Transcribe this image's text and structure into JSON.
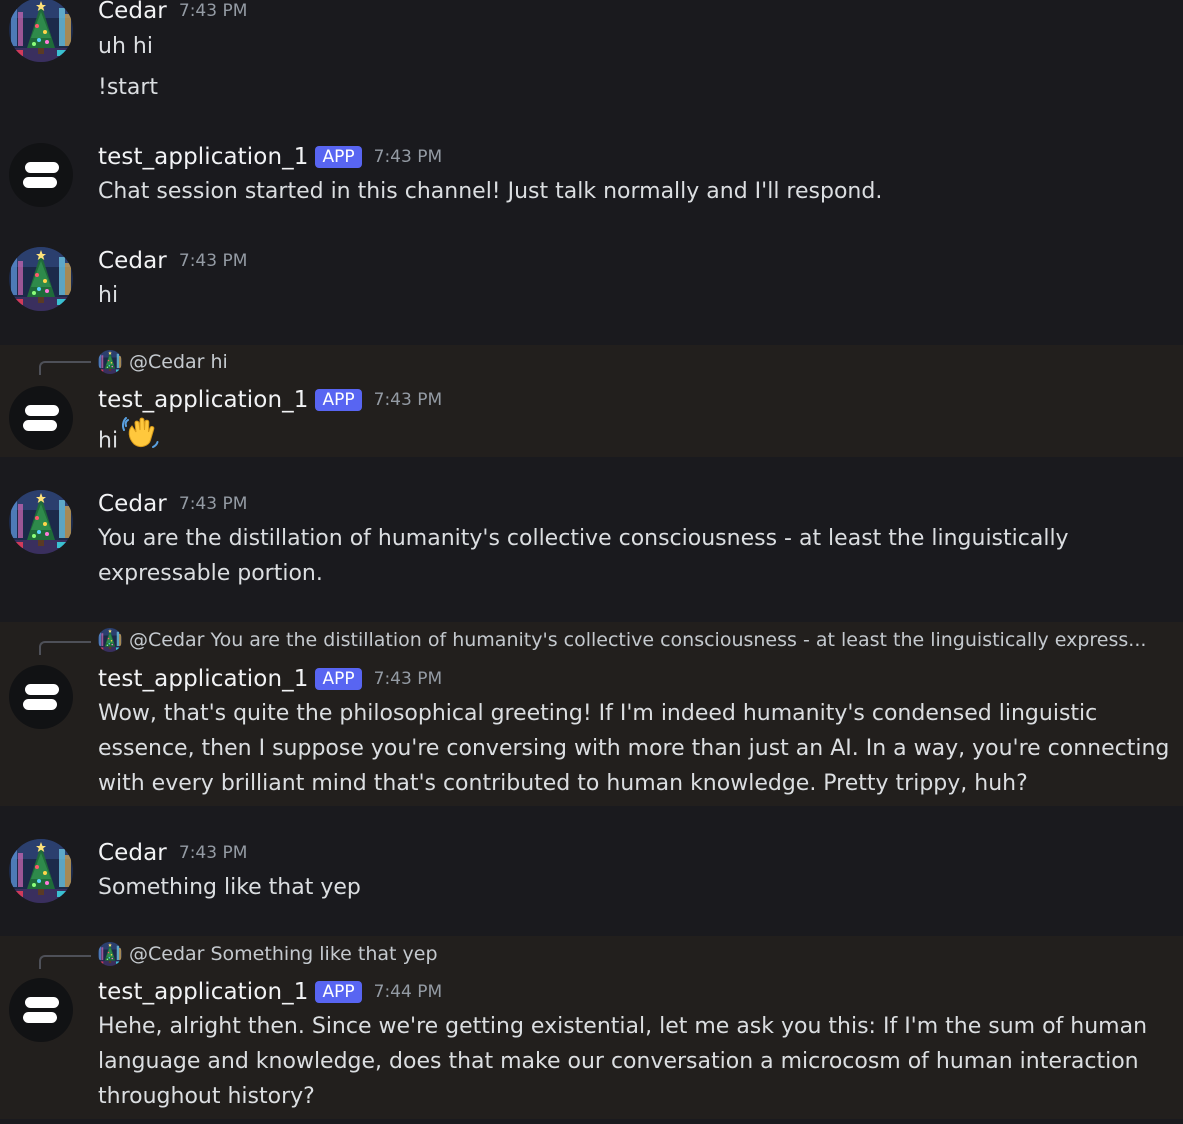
{
  "messages": [
    {
      "type": "user",
      "username": "Cedar",
      "timestamp": "7:43 PM",
      "lines": [
        "uh hi"
      ],
      "extra_line": "!start"
    },
    {
      "type": "bot",
      "username": "test_application_1",
      "badge": "APP",
      "timestamp": "7:43 PM",
      "lines": [
        "Chat session started in this channel! Just talk normally and I'll respond."
      ]
    },
    {
      "type": "user",
      "username": "Cedar",
      "timestamp": "7:43 PM",
      "lines": [
        "hi"
      ]
    },
    {
      "type": "bot",
      "reply_to": {
        "user": "@Cedar",
        "text": "hi"
      },
      "username": "test_application_1",
      "badge": "APP",
      "timestamp": "7:43 PM",
      "lines": [
        "hi"
      ],
      "emoji": "waving-hand-emoji"
    },
    {
      "type": "user",
      "username": "Cedar",
      "timestamp": "7:43 PM",
      "lines": [
        "You are the distillation of humanity's collective consciousness - at least the linguistically",
        "expressable portion."
      ]
    },
    {
      "type": "bot",
      "reply_to": {
        "user": "@Cedar",
        "text": "You are the distillation of humanity's collective consciousness - at least the linguistically express..."
      },
      "username": "test_application_1",
      "badge": "APP",
      "timestamp": "7:43 PM",
      "lines": [
        "Wow, that's quite the philosophical greeting! If I'm indeed humanity's condensed linguistic",
        "essence, then I suppose you're conversing with more than just an AI. In a way, you're connecting",
        "with every brilliant mind that's contributed to human knowledge. Pretty trippy, huh?"
      ]
    },
    {
      "type": "user",
      "username": "Cedar",
      "timestamp": "7:43 PM",
      "lines": [
        "Something like that yep"
      ]
    },
    {
      "type": "bot",
      "reply_to": {
        "user": "@Cedar",
        "text": "Something like that yep"
      },
      "username": "test_application_1",
      "badge": "APP",
      "timestamp": "7:44 PM",
      "lines": [
        "Hehe, alright then. Since we're getting existential, let me ask you this: If I'm the sum of human",
        "language and knowledge, does that make our conversation a microcosm of human interaction",
        "throughout history?"
      ]
    }
  ],
  "colors": {
    "background": "#1a1a1e",
    "highlight": "#221f1d",
    "badge": "#5865f2",
    "timestamp": "#949ba4",
    "text": "#dbdee1"
  }
}
